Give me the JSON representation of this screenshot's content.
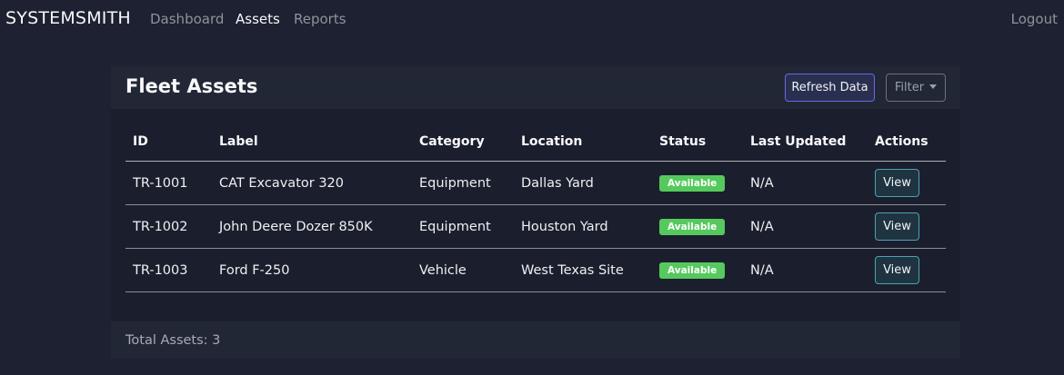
{
  "brand": "SYSTEMSMITH",
  "nav": {
    "dashboard": "Dashboard",
    "assets": "Assets",
    "reports": "Reports",
    "logout": "Logout",
    "active": "Assets"
  },
  "card": {
    "title": "Fleet Assets",
    "refresh_label": "Refresh Data",
    "filter_label": "Filter"
  },
  "table": {
    "headers": [
      "ID",
      "Label",
      "Category",
      "Location",
      "Status",
      "Last Updated",
      "Actions"
    ],
    "rows": [
      {
        "id": "TR-1001",
        "label": "CAT Excavator 320",
        "category": "Equipment",
        "location": "Dallas Yard",
        "status": "Available",
        "last_updated": "N/A",
        "action": "View"
      },
      {
        "id": "TR-1002",
        "label": "John Deere Dozer 850K",
        "category": "Equipment",
        "location": "Houston Yard",
        "status": "Available",
        "last_updated": "N/A",
        "action": "View"
      },
      {
        "id": "TR-1003",
        "label": "Ford F-250",
        "category": "Vehicle",
        "location": "West Texas Site",
        "status": "Available",
        "last_updated": "N/A",
        "action": "View"
      }
    ]
  },
  "footer": {
    "total_text": "Total Assets: 3"
  },
  "colors": {
    "background": "#1d2131",
    "card_header": "#222736",
    "status_available": "#55c95e",
    "primary_outline": "#6f63e8",
    "info_outline": "#4aa3b7"
  }
}
